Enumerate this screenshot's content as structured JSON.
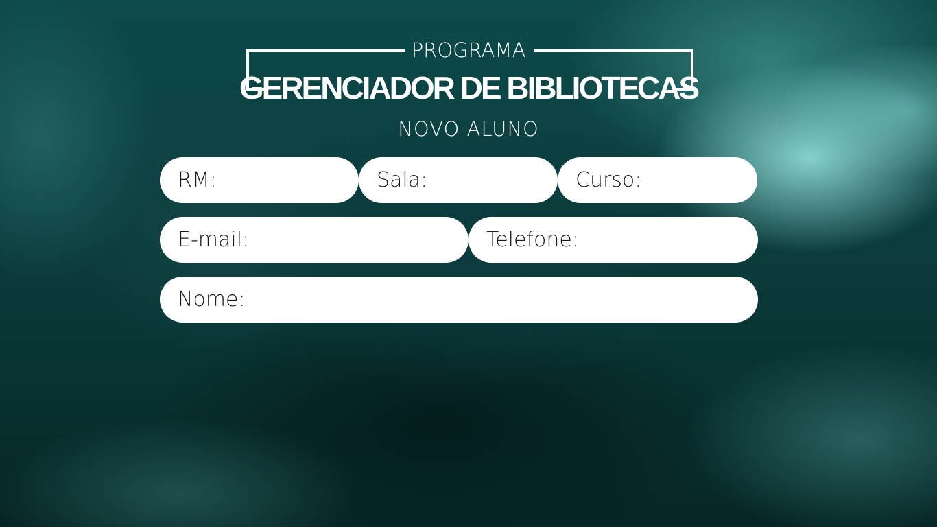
{
  "header": {
    "program_label": "PROGRAMA",
    "app_title": "GERENCIADOR DE BIBLIOTECAS",
    "subtitle": "NOVO ALUNO"
  },
  "form": {
    "rm": {
      "label": "RM:",
      "value": ""
    },
    "sala": {
      "label": "Sala:",
      "value": ""
    },
    "curso": {
      "label": "Curso:",
      "value": ""
    },
    "email": {
      "label": "E-mail:",
      "value": ""
    },
    "telefone": {
      "label": "Telefone:",
      "value": ""
    },
    "nome": {
      "label": "Nome:",
      "value": ""
    }
  },
  "colors": {
    "background": "#0b3b3b",
    "field_background": "#ffffff",
    "text_on_background": "#ffffff"
  }
}
